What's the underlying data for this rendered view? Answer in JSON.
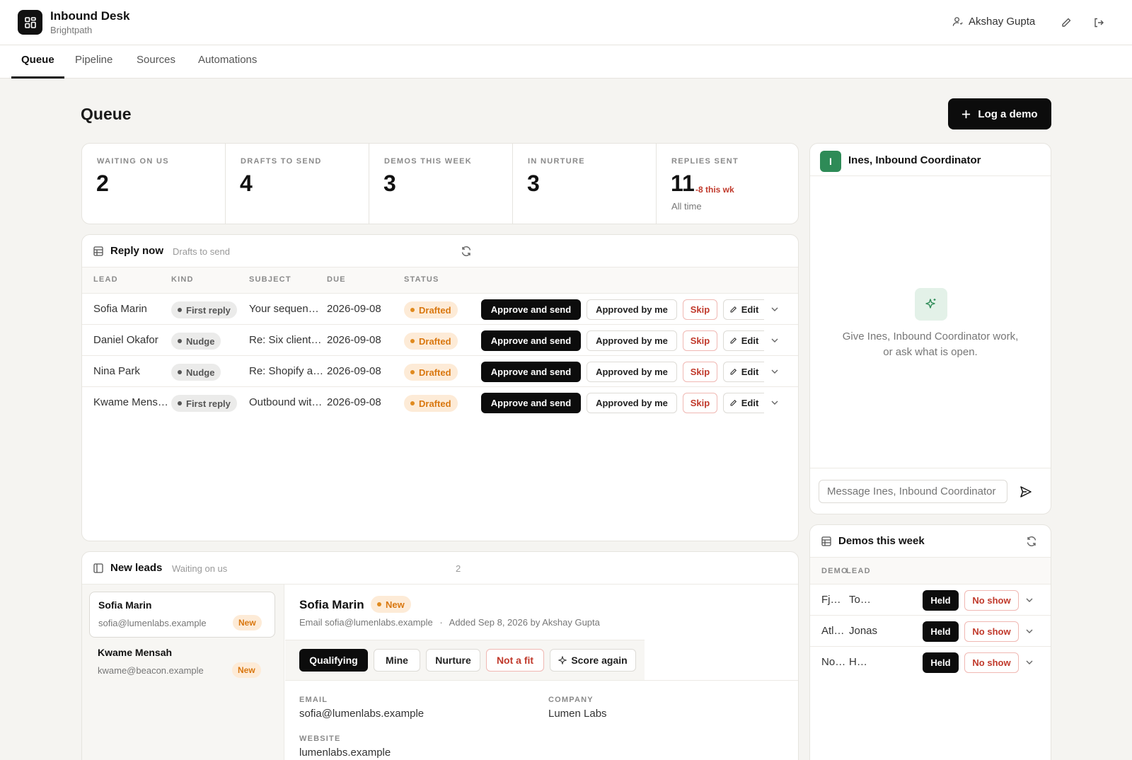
{
  "app": {
    "name": "Inbound Desk",
    "org": "Brightpath"
  },
  "header": {
    "user": "Akshay Gupta"
  },
  "nav": {
    "tabs": [
      "Queue",
      "Pipeline",
      "Sources",
      "Automations"
    ],
    "active": "Queue"
  },
  "page": {
    "title": "Queue",
    "primary_action": "Log a demo"
  },
  "stats": [
    {
      "label": "WAITING ON US",
      "value": "2"
    },
    {
      "label": "DRAFTS TO SEND",
      "value": "4"
    },
    {
      "label": "DEMOS THIS WEEK",
      "value": "3"
    },
    {
      "label": "IN NURTURE",
      "value": "3"
    },
    {
      "label": "REPLIES SENT",
      "value": "11",
      "delta": "-8 this wk",
      "sub": "All time"
    }
  ],
  "reply_now": {
    "title": "Reply now",
    "subtitle": "Drafts to send",
    "columns": [
      "LEAD",
      "KIND",
      "SUBJECT",
      "DUE",
      "STATUS"
    ],
    "actions": {
      "approve": "Approve and send",
      "approved": "Approved by me",
      "skip": "Skip",
      "edit": "Edit"
    },
    "rows": [
      {
        "lead": "Sofia Marin",
        "kind": "First reply",
        "subject": "Your sequence volume",
        "due": "2026-09-08",
        "status": "Drafted"
      },
      {
        "lead": "Daniel Okafor",
        "kind": "Nudge",
        "subject": "Re: Six clients onboarding",
        "due": "2026-09-08",
        "status": "Drafted"
      },
      {
        "lead": "Nina Park",
        "kind": "Nudge",
        "subject": "Re: Shopify apps",
        "due": "2026-09-08",
        "status": "Drafted"
      },
      {
        "lead": "Kwame Mensah",
        "kind": "First reply",
        "subject": "Outbound with Beacon",
        "due": "2026-09-08",
        "status": "Drafted"
      }
    ]
  },
  "new_leads": {
    "title": "New leads",
    "subtitle": "Waiting on us",
    "count": "2",
    "list": [
      {
        "name": "Sofia Marin",
        "email": "sofia@lumenlabs.example",
        "badge": "New"
      },
      {
        "name": "Kwame Mensah",
        "email": "kwame@beacon.example",
        "badge": "New"
      }
    ],
    "detail": {
      "name": "Sofia Marin",
      "badge": "New",
      "meta_email": "Email sofia@lumenlabs.example",
      "meta_sep": "·",
      "meta_added": "Added Sep 8, 2026 by Akshay Gupta",
      "stages": [
        "Qualifying",
        "Mine",
        "Nurture",
        "Not a fit",
        "Score again"
      ],
      "fields": {
        "email_label": "EMAIL",
        "email": "sofia@lumenlabs.example",
        "company_label": "COMPANY",
        "company": "Lumen Labs",
        "website_label": "WEBSITE",
        "website": "lumenlabs.example"
      }
    }
  },
  "assistant": {
    "avatar": "I",
    "name": "Ines, Inbound Coordinator",
    "empty_text_1": "Give Ines, Inbound Coordinator work,",
    "empty_text_2": "or ask what is open.",
    "input_placeholder": "Message Ines, Inbound Coordinator"
  },
  "demos": {
    "title": "Demos this week",
    "col_demo": "DEMO",
    "col_lead": "LEAD",
    "held": "Held",
    "no_show": "No show",
    "rows": [
      {
        "demo": "Fjord",
        "lead": "Tomas"
      },
      {
        "demo": "Atlas",
        "lead": "Jonas"
      },
      {
        "demo": "Northwind",
        "lead": "Hana"
      }
    ]
  },
  "colors": {
    "accent": "#0c0c0c",
    "warning": "#d9770f",
    "danger": "#c0392b",
    "assistant": "#2e8b57"
  }
}
